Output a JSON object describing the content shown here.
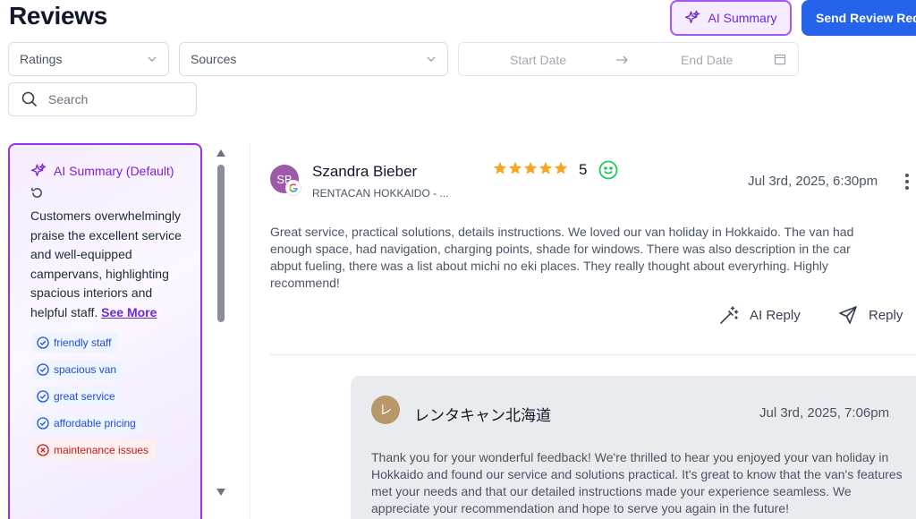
{
  "page": {
    "title": "Reviews"
  },
  "header": {
    "ai_summary_label": "AI Summary",
    "send_request_label": "Send Review Requ"
  },
  "filters": {
    "ratings_label": "Ratings",
    "sources_label": "Sources",
    "start_date_placeholder": "Start Date",
    "end_date_placeholder": "End Date",
    "search_placeholder": "Search"
  },
  "summary": {
    "title": "AI Summary (Default)",
    "text": "Customers overwhelmingly praise the excellent service and well-equipped campervans, highlighting spacious interiors and helpful staff.",
    "see_more": "See More",
    "tags": [
      {
        "label": "friendly staff",
        "sentiment": "positive"
      },
      {
        "label": "spacious van",
        "sentiment": "positive"
      },
      {
        "label": "great service",
        "sentiment": "positive"
      },
      {
        "label": "affordable pricing",
        "sentiment": "positive"
      },
      {
        "label": "maintenance issues",
        "sentiment": "negative"
      }
    ]
  },
  "review": {
    "initials": "SB",
    "name": "Szandra Bieber",
    "source": "RENTACAN HOKKAIDO - ...",
    "rating": 5,
    "rating_label": "5",
    "sentiment_icon": "smiley-icon",
    "date": "Jul 3rd, 2025, 6:30pm",
    "text": "Great service, practical solutions, details instructions. We loved our van holiday in Hokkaido. The van had enough space, had navigation, charging points, shade for windows. There was also description in the car abput fueling, there was a list about michi no eki places. They really thought about everyrhing. Highly recommend!",
    "ai_reply_label": "AI Reply",
    "reply_label": "Reply"
  },
  "reply": {
    "initial": "レ",
    "name": "レンタキャン北海道",
    "date": "Jul 3rd, 2025, 7:06pm",
    "text": "Thank you for your wonderful feedback! We're thrilled to hear you enjoyed your van holiday in Hokkaido and found our service and solutions practical. It's great to know that the van's features met your needs and that our detailed instructions made your experience seamless. We appreciate your recommendation and hope to serve you again in the future!"
  },
  "colors": {
    "accent_purple": "#9333ea",
    "primary_blue": "#2563eb",
    "star": "#f5a623",
    "positive_green": "#22c55e",
    "negative_red": "#dc2626"
  }
}
